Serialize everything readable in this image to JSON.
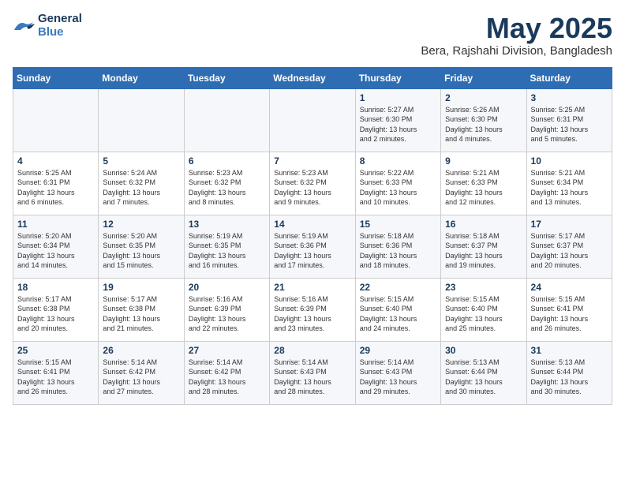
{
  "logo": {
    "line1": "General",
    "line2": "Blue"
  },
  "title": "May 2025",
  "subtitle": "Bera, Rajshahi Division, Bangladesh",
  "weekdays": [
    "Sunday",
    "Monday",
    "Tuesday",
    "Wednesday",
    "Thursday",
    "Friday",
    "Saturday"
  ],
  "weeks": [
    [
      {
        "day": "",
        "info": ""
      },
      {
        "day": "",
        "info": ""
      },
      {
        "day": "",
        "info": ""
      },
      {
        "day": "",
        "info": ""
      },
      {
        "day": "1",
        "info": "Sunrise: 5:27 AM\nSunset: 6:30 PM\nDaylight: 13 hours\nand 2 minutes."
      },
      {
        "day": "2",
        "info": "Sunrise: 5:26 AM\nSunset: 6:30 PM\nDaylight: 13 hours\nand 4 minutes."
      },
      {
        "day": "3",
        "info": "Sunrise: 5:25 AM\nSunset: 6:31 PM\nDaylight: 13 hours\nand 5 minutes."
      }
    ],
    [
      {
        "day": "4",
        "info": "Sunrise: 5:25 AM\nSunset: 6:31 PM\nDaylight: 13 hours\nand 6 minutes."
      },
      {
        "day": "5",
        "info": "Sunrise: 5:24 AM\nSunset: 6:32 PM\nDaylight: 13 hours\nand 7 minutes."
      },
      {
        "day": "6",
        "info": "Sunrise: 5:23 AM\nSunset: 6:32 PM\nDaylight: 13 hours\nand 8 minutes."
      },
      {
        "day": "7",
        "info": "Sunrise: 5:23 AM\nSunset: 6:32 PM\nDaylight: 13 hours\nand 9 minutes."
      },
      {
        "day": "8",
        "info": "Sunrise: 5:22 AM\nSunset: 6:33 PM\nDaylight: 13 hours\nand 10 minutes."
      },
      {
        "day": "9",
        "info": "Sunrise: 5:21 AM\nSunset: 6:33 PM\nDaylight: 13 hours\nand 12 minutes."
      },
      {
        "day": "10",
        "info": "Sunrise: 5:21 AM\nSunset: 6:34 PM\nDaylight: 13 hours\nand 13 minutes."
      }
    ],
    [
      {
        "day": "11",
        "info": "Sunrise: 5:20 AM\nSunset: 6:34 PM\nDaylight: 13 hours\nand 14 minutes."
      },
      {
        "day": "12",
        "info": "Sunrise: 5:20 AM\nSunset: 6:35 PM\nDaylight: 13 hours\nand 15 minutes."
      },
      {
        "day": "13",
        "info": "Sunrise: 5:19 AM\nSunset: 6:35 PM\nDaylight: 13 hours\nand 16 minutes."
      },
      {
        "day": "14",
        "info": "Sunrise: 5:19 AM\nSunset: 6:36 PM\nDaylight: 13 hours\nand 17 minutes."
      },
      {
        "day": "15",
        "info": "Sunrise: 5:18 AM\nSunset: 6:36 PM\nDaylight: 13 hours\nand 18 minutes."
      },
      {
        "day": "16",
        "info": "Sunrise: 5:18 AM\nSunset: 6:37 PM\nDaylight: 13 hours\nand 19 minutes."
      },
      {
        "day": "17",
        "info": "Sunrise: 5:17 AM\nSunset: 6:37 PM\nDaylight: 13 hours\nand 20 minutes."
      }
    ],
    [
      {
        "day": "18",
        "info": "Sunrise: 5:17 AM\nSunset: 6:38 PM\nDaylight: 13 hours\nand 20 minutes."
      },
      {
        "day": "19",
        "info": "Sunrise: 5:17 AM\nSunset: 6:38 PM\nDaylight: 13 hours\nand 21 minutes."
      },
      {
        "day": "20",
        "info": "Sunrise: 5:16 AM\nSunset: 6:39 PM\nDaylight: 13 hours\nand 22 minutes."
      },
      {
        "day": "21",
        "info": "Sunrise: 5:16 AM\nSunset: 6:39 PM\nDaylight: 13 hours\nand 23 minutes."
      },
      {
        "day": "22",
        "info": "Sunrise: 5:15 AM\nSunset: 6:40 PM\nDaylight: 13 hours\nand 24 minutes."
      },
      {
        "day": "23",
        "info": "Sunrise: 5:15 AM\nSunset: 6:40 PM\nDaylight: 13 hours\nand 25 minutes."
      },
      {
        "day": "24",
        "info": "Sunrise: 5:15 AM\nSunset: 6:41 PM\nDaylight: 13 hours\nand 26 minutes."
      }
    ],
    [
      {
        "day": "25",
        "info": "Sunrise: 5:15 AM\nSunset: 6:41 PM\nDaylight: 13 hours\nand 26 minutes."
      },
      {
        "day": "26",
        "info": "Sunrise: 5:14 AM\nSunset: 6:42 PM\nDaylight: 13 hours\nand 27 minutes."
      },
      {
        "day": "27",
        "info": "Sunrise: 5:14 AM\nSunset: 6:42 PM\nDaylight: 13 hours\nand 28 minutes."
      },
      {
        "day": "28",
        "info": "Sunrise: 5:14 AM\nSunset: 6:43 PM\nDaylight: 13 hours\nand 28 minutes."
      },
      {
        "day": "29",
        "info": "Sunrise: 5:14 AM\nSunset: 6:43 PM\nDaylight: 13 hours\nand 29 minutes."
      },
      {
        "day": "30",
        "info": "Sunrise: 5:13 AM\nSunset: 6:44 PM\nDaylight: 13 hours\nand 30 minutes."
      },
      {
        "day": "31",
        "info": "Sunrise: 5:13 AM\nSunset: 6:44 PM\nDaylight: 13 hours\nand 30 minutes."
      }
    ]
  ]
}
